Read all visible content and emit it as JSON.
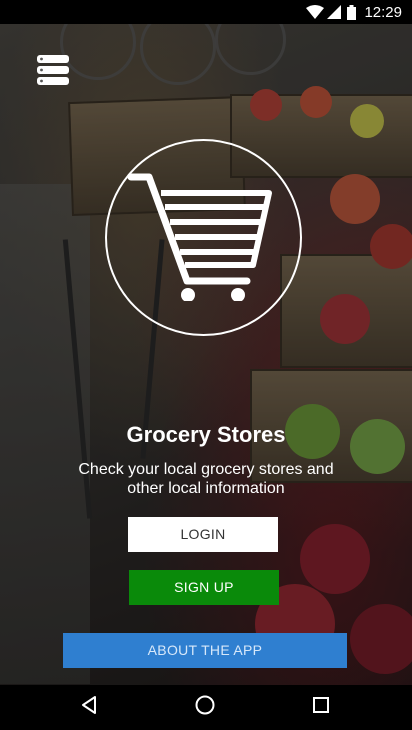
{
  "status_bar": {
    "time": "12:29",
    "icons": [
      "wifi-icon",
      "signal-icon",
      "battery-icon"
    ]
  },
  "header": {
    "menu_icon": "server-stack-icon"
  },
  "hero": {
    "logo_icon": "shopping-cart-icon",
    "title": "Grocery Stores",
    "subtitle_line1": "Check your local grocery stores and",
    "subtitle_line2": "other local information"
  },
  "buttons": {
    "login": "LOGIN",
    "signup": "SIGN UP",
    "about": "ABOUT THE APP"
  },
  "nav_bar": {
    "icons": [
      "back-icon",
      "home-icon",
      "recents-icon"
    ]
  },
  "colors": {
    "signup_bg": "#0a8a0a",
    "about_bg": "#2f7fd0",
    "login_bg": "#ffffff"
  }
}
